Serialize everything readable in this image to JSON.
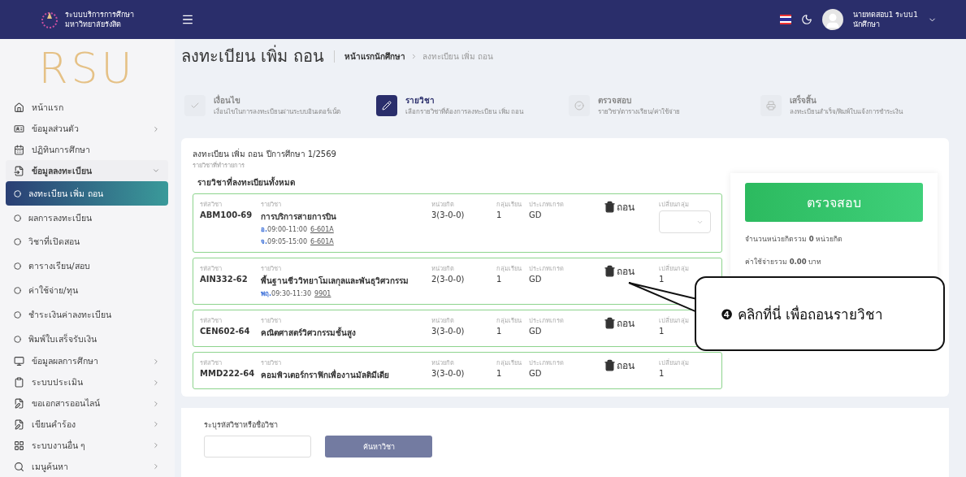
{
  "topbar": {
    "org_name": "ระบบบริการการศึกษา",
    "org_subname": "มหาวิทยาลัยรังสิต",
    "user_name": "นายทดสอบ1 ระบบ1",
    "user_role": "นักศึกษา"
  },
  "sidebar": {
    "logo_text": "RSU",
    "items": [
      {
        "label": "หน้าแรก",
        "kind": "home",
        "selected": false
      },
      {
        "label": "ข้อมูลส่วนตัว",
        "kind": "profile",
        "selected": false,
        "expanded": false
      },
      {
        "label": "ปฏิทินการศึกษา",
        "kind": "calendar",
        "selected": false
      },
      {
        "label": "ข้อมูลลงทะเบียน",
        "kind": "register",
        "selected": false,
        "expanded": true,
        "children": [
          {
            "label": "ลงทะเบียน เพิ่ม ถอน",
            "selected": true
          },
          {
            "label": "ผลการลงทะเบียน",
            "selected": false
          },
          {
            "label": "วิชาที่เปิดสอน",
            "selected": false
          },
          {
            "label": "ตารางเรียน/สอบ",
            "selected": false
          },
          {
            "label": "ค่าใช้จ่าย/ทุน",
            "selected": false
          },
          {
            "label": "ชำระเงินค่าลงทะเบียน",
            "selected": false
          },
          {
            "label": "พิมพ์ใบเสร็จรับเงิน",
            "selected": false
          }
        ]
      },
      {
        "label": "ข้อมูลผลการศึกษา",
        "kind": "results",
        "selected": false,
        "expanded": false
      },
      {
        "label": "ระบบประเมิน",
        "kind": "clipboard",
        "selected": false,
        "expanded": false
      },
      {
        "label": "ขอเอกสารออนไลน์",
        "kind": "document",
        "selected": false,
        "expanded": false
      },
      {
        "label": "เขียนคำร้อง",
        "kind": "document",
        "selected": false,
        "expanded": false
      },
      {
        "label": "ระบบงานอื่น ๆ",
        "kind": "apps",
        "selected": false,
        "expanded": false
      },
      {
        "label": "เมนูค้นหา",
        "kind": "search",
        "selected": false,
        "expanded": false
      }
    ]
  },
  "page": {
    "title": "ลงทะเบียน เพิ่ม ถอน",
    "breadcrumb": [
      {
        "label": "หน้าแรกนักศึกษา",
        "kind": "link"
      },
      {
        "label": "ลงทะเบียน เพิ่ม ถอน",
        "kind": "current"
      }
    ]
  },
  "steps": [
    {
      "title": "เงื่อนไข",
      "subtitle": "เงื่อนไขในการลงทะเบียนผ่านระบบอินเตอร์เน็ต",
      "kind": "check",
      "selected": false
    },
    {
      "title": "รายวิชา",
      "subtitle": "เลือกรายวิชาที่ต้องการลงทะเบียน เพิ่ม ถอน",
      "kind": "edit",
      "selected": true
    },
    {
      "title": "ตรวจสอบ",
      "subtitle": "รายวิชา/ตารางเรียน/ค่าใช้จ่าย",
      "kind": "verify",
      "selected": false
    },
    {
      "title": "เสร็จสิ้น",
      "subtitle": "ลงทะเบียนสำเร็จ/พิมพ์ใบแจ้งการชำระเงิน",
      "kind": "print",
      "selected": false
    }
  ],
  "registration": {
    "title": "ลงทะเบียน เพิ่ม ถอน ปีการศึกษา 1/2569",
    "subtitle": "รายวิชาที่ทำรายการ",
    "list_title": "รายวิชาที่ลงทะเบียนทั้งหมด",
    "courses": [
      {
        "labels": {
          "code": "รหัสวิชา",
          "name": "รายวิชา",
          "credits": "หน่วยกิต",
          "section": "กลุ่มเรียน",
          "grade_type": "ประเภทเกรด",
          "change": "เปลี่ยนกลุ่ม"
        },
        "code": "ABM100-69",
        "name": "การบริการสายการบิน",
        "credits": "3(3-0-0)",
        "section": "1",
        "grade_type": "GD",
        "drop_label": "ถอน",
        "change": {
          "kind": "select"
        },
        "sessions": [
          {
            "day": "อ.",
            "time": "09:00-11:00",
            "room": "6-601A"
          },
          {
            "day": "จ.",
            "time": "09:05-15:00",
            "room": "6-601A"
          }
        ]
      },
      {
        "labels": {
          "code": "รหัสวิชา",
          "name": "รายวิชา",
          "credits": "หน่วยกิต",
          "section": "กลุ่มเรียน",
          "grade_type": "ประเภทเกรด",
          "change": "เปลี่ยนกลุ่ม"
        },
        "code": "AIN332-62",
        "name": "พื้นฐานชีววิทยาโมเลกุลและพันธุวิศวกรรม",
        "credits": "2(3-0-0)",
        "section": "1",
        "grade_type": "GD",
        "drop_label": "ถอน",
        "change": {
          "kind": "text",
          "value": "1"
        },
        "sessions": [
          {
            "day": "พฤ.",
            "time": "09:30-11:30",
            "room": "9901"
          }
        ]
      },
      {
        "labels": {
          "code": "รหัสวิชา",
          "name": "รายวิชา",
          "credits": "หน่วยกิต",
          "section": "กลุ่มเรียน",
          "grade_type": "ประเภทเกรด",
          "change": "เปลี่ยนกลุ่ม"
        },
        "code": "CEN602-64",
        "name": "คณิตศาสตร์วิศวกรรมชั้นสูง",
        "credits": "3(3-0-0)",
        "section": "1",
        "grade_type": "GD",
        "drop_label": "ถอน",
        "change": {
          "kind": "text",
          "value": "1"
        }
      },
      {
        "labels": {
          "code": "รหัสวิชา",
          "name": "รายวิชา",
          "credits": "หน่วยกิต",
          "section": "กลุ่มเรียน",
          "grade_type": "ประเภทเกรด",
          "change": "เปลี่ยนกลุ่ม"
        },
        "code": "MMD222-64",
        "name": "คอมพิวเตอร์กราฟิกเพื่องานมัลติมีเดีย",
        "credits": "3(3-0-0)",
        "section": "1",
        "grade_type": "GD",
        "drop_label": "ถอน",
        "change": {
          "kind": "text",
          "value": "1"
        }
      }
    ]
  },
  "summary": {
    "check_button": "ตรวจสอบ",
    "credits_prefix": "จำนวนหน่วยกิตรวม",
    "credits_value": "0",
    "credits_suffix": "หน่วยกิต",
    "cost_prefix": "ค่าใช้จ่ายรวม",
    "cost_value": "0.00",
    "cost_suffix": "บาท"
  },
  "search": {
    "label": "ระบุรหัสวิชาหรือชื่อวิชา",
    "button": "ค้นหาวิชา"
  },
  "callout": {
    "text": "❹ คลิกที่นี่ เพื่อถอนรายวิชา"
  }
}
